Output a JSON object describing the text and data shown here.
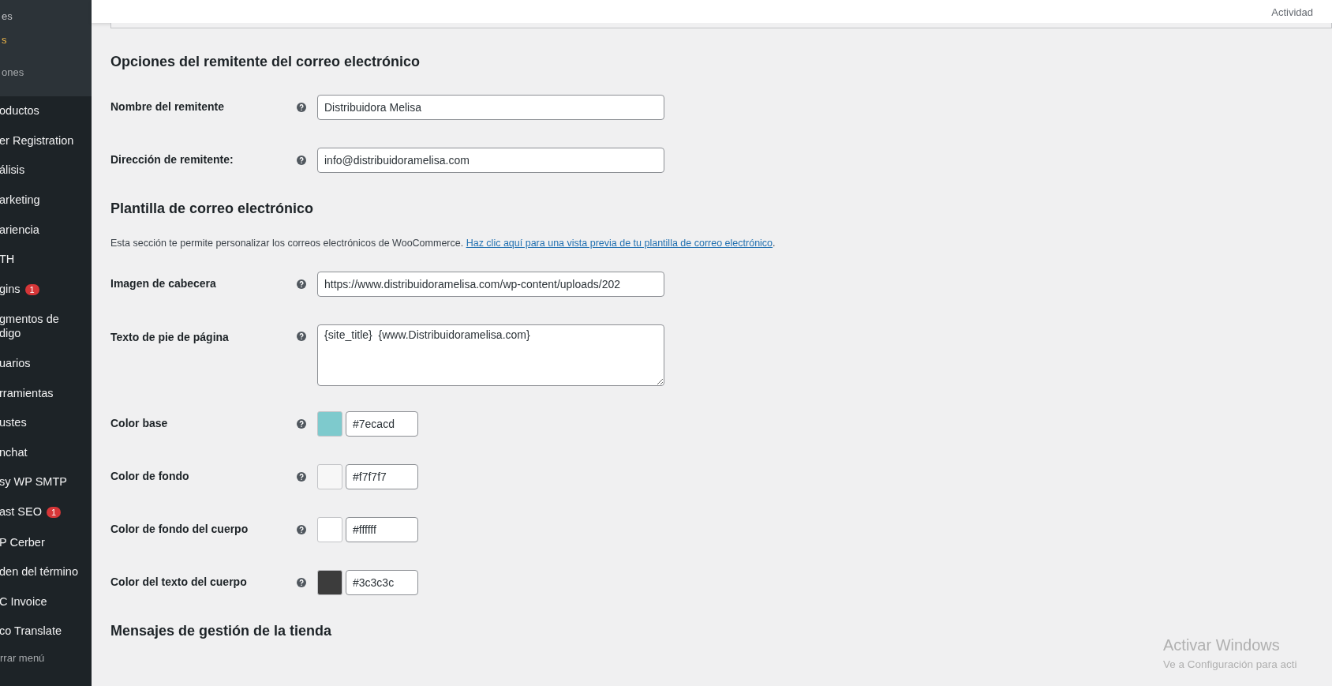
{
  "sidebar": {
    "submenu": [
      {
        "label": "es",
        "selected": false
      },
      {
        "label": "s",
        "selected": true
      }
    ],
    "group_label": "ones",
    "items": [
      {
        "label": "oductos"
      },
      {
        "label": "er Registration"
      },
      {
        "label": "álisis"
      },
      {
        "label": "arketing"
      },
      {
        "label": "ariencia"
      },
      {
        "label": "TH"
      },
      {
        "label": "gins",
        "badge": "1"
      },
      {
        "label": "gmentos de\ndigo"
      },
      {
        "label": "uarios"
      },
      {
        "label": "rramientas"
      },
      {
        "label": "ustes"
      },
      {
        "label": "nchat"
      },
      {
        "label": "sy WP SMTP"
      },
      {
        "label": "ast SEO",
        "badge": "1"
      },
      {
        "label": "P Cerber"
      },
      {
        "label": "den del término"
      },
      {
        "label": "C Invoice"
      },
      {
        "label": "co Translate"
      }
    ],
    "collapse": "rrar menú"
  },
  "header": {
    "activity": "Actividad"
  },
  "sections": [
    {
      "title": "Opciones del remitente del correo electrónico",
      "fields": [
        {
          "kind": "text",
          "label": "Nombre del remitente",
          "value": "Distribuidora Melisa"
        },
        {
          "kind": "text",
          "label": "Dirección de remitente:",
          "value": "info@distribuidoramelisa.com"
        }
      ]
    },
    {
      "title": "Plantilla de correo electrónico",
      "description": "Esta sección te permite personalizar los correos electrónicos de WooCommerce. ",
      "link": "Haz clic aquí para una vista previa de tu plantilla de correo electrónico",
      "after_link": ".",
      "fields": [
        {
          "kind": "text",
          "label": "Imagen de cabecera",
          "value": "https://www.distribuidoramelisa.com/wp-content/uploads/202"
        },
        {
          "kind": "textarea",
          "label": "Texto de pie de página",
          "value": "{site_title}  {www.Distribuidoramelisa.com}"
        },
        {
          "kind": "color",
          "label": "Color base",
          "value": "#7ecacd",
          "color": "#7ecacd"
        },
        {
          "kind": "color",
          "label": "Color de fondo",
          "value": "#f7f7f7",
          "color": "#f7f7f7"
        },
        {
          "kind": "color",
          "label": "Color de fondo del cuerpo",
          "value": "#ffffff",
          "color": "#ffffff"
        },
        {
          "kind": "color",
          "label": "Color del texto del cuerpo",
          "value": "#3c3c3c",
          "color": "#3c3c3c"
        }
      ]
    },
    {
      "title": "Mensajes de gestión de la tienda"
    }
  ],
  "os_notice": {
    "title": "Activar Windows",
    "text": "Ve a Configuración para acti"
  }
}
